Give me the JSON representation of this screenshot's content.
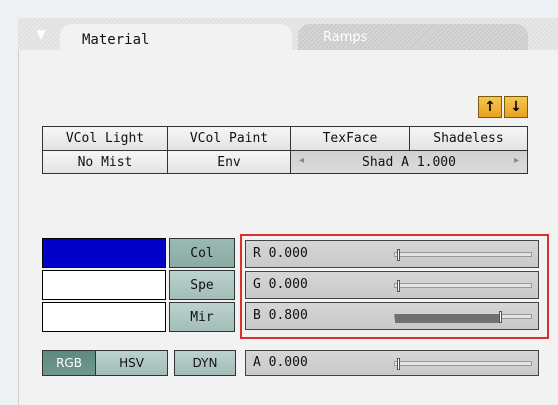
{
  "tabs": {
    "active": "Material",
    "inactive": "Ramps",
    "collapse_glyph": "▼"
  },
  "arrows": {
    "up": "🠕",
    "down": "🠗",
    "up_text": "↑",
    "down_text": "↓"
  },
  "toggles": {
    "row1": [
      "VCol Light",
      "VCol Paint",
      "TexFace",
      "Shadeless"
    ],
    "row2": [
      "No Mist",
      "Env"
    ],
    "shad_label": "Shad A 1.000",
    "shad_left": "◂",
    "shad_right": "▸"
  },
  "swatches": {
    "col": "#0000c8",
    "spe": "#ffffff",
    "mir": "#ffffff"
  },
  "channels": [
    "Col",
    "Spe",
    "Mir"
  ],
  "sliders": {
    "r": {
      "label": "R 0.000",
      "value": 0.0
    },
    "g": {
      "label": "G 0.000",
      "value": 0.0
    },
    "b": {
      "label": "B 0.800",
      "value": 0.8
    },
    "a": {
      "label": "A 0.000",
      "value": 0.0
    }
  },
  "modes": [
    "RGB",
    "HSV",
    "DYN"
  ],
  "highlight_color": "#d9302c"
}
